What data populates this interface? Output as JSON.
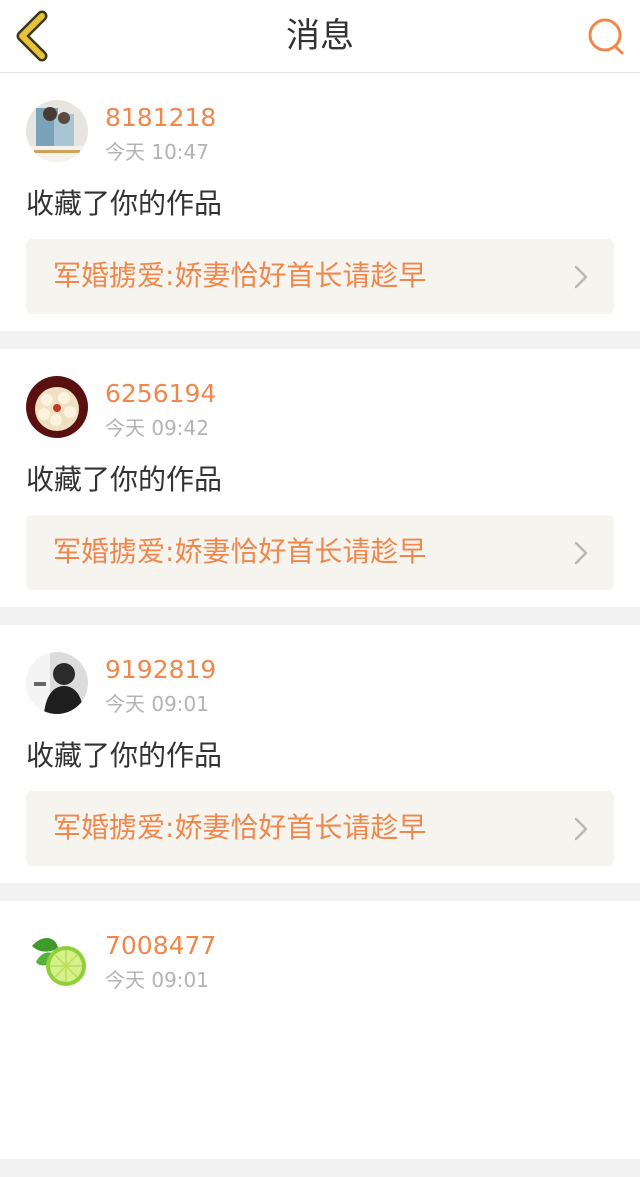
{
  "header": {
    "title": "消息",
    "back_icon": "chevron-left-icon",
    "search_icon": "search-icon",
    "back_color": "#e9c23a",
    "search_color": "#f0884d"
  },
  "colors": {
    "accent": "#f0884d",
    "text": "#333333",
    "muted": "#b3b3b3",
    "card_link_bg": "#f5f4ef"
  },
  "messages": [
    {
      "username": "8181218",
      "time": "今天 10:47",
      "action": "收藏了你的作品",
      "work_title": "军婚掳爱:娇妻恰好首长请趁早",
      "avatar": "photo-avatar-icon"
    },
    {
      "username": "6256194",
      "time": "今天 09:42",
      "action": "收藏了你的作品",
      "work_title": "军婚掳爱:娇妻恰好首长请趁早",
      "avatar": "flower-avatar-icon"
    },
    {
      "username": "9192819",
      "time": "今天 09:01",
      "action": "收藏了你的作品",
      "work_title": "军婚掳爱:娇妻恰好首长请趁早",
      "avatar": "portrait-avatar-icon"
    },
    {
      "username": "7008477",
      "time": "今天 09:01",
      "avatar": "lime-avatar-icon"
    }
  ]
}
